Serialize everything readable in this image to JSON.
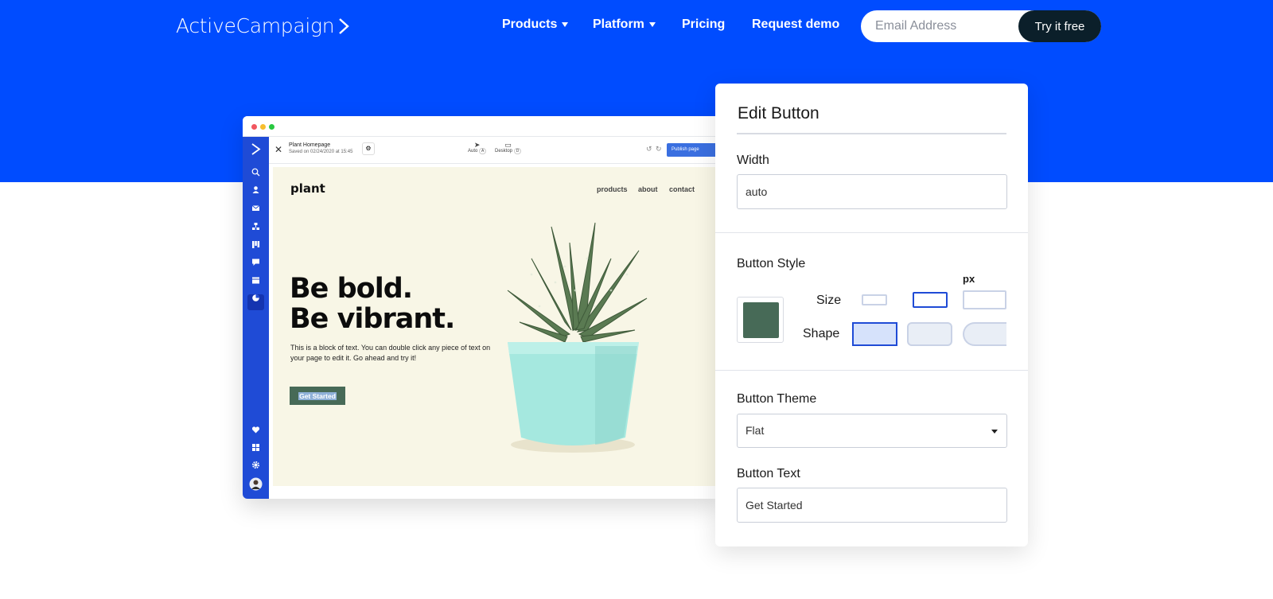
{
  "brand": {
    "name": "ActiveCampaign",
    "accent": "#004cff"
  },
  "nav": {
    "items": [
      {
        "label": "Products",
        "dropdown": true
      },
      {
        "label": "Platform",
        "dropdown": true
      },
      {
        "label": "Pricing",
        "dropdown": false
      },
      {
        "label": "Request demo",
        "dropdown": false
      }
    ],
    "email_placeholder": "Email Address",
    "cta_label": "Try it free"
  },
  "editor": {
    "page_name": "Plant Homepage",
    "saved_text": "Saved on 02/24/2020 at 15:45",
    "view_auto": "Auto",
    "view_auto_key": "A",
    "view_desktop": "Desktop",
    "view_desktop_key": "D",
    "publish_label": "Publish page",
    "sidebar_icons": [
      "search-icon",
      "contacts-icon",
      "email-icon",
      "automation-icon",
      "deals-icon",
      "conversations-icon",
      "pages-icon",
      "reports-icon",
      "heart-icon",
      "apps-icon",
      "settings-icon",
      "avatar"
    ]
  },
  "site": {
    "logo": "plant",
    "nav": [
      "products",
      "about",
      "contact"
    ],
    "headline_1": "Be bold.",
    "headline_2": "Be vibrant.",
    "paragraph": "This is a block of text. You can double click any piece of text on your page to edit it. Go ahead and try it!",
    "button_label": "Get Started",
    "button_color": "#476a57",
    "background": "#f8f6e6"
  },
  "panel": {
    "title": "Edit Button",
    "width_label": "Width",
    "width_value": "auto",
    "style_label": "Button Style",
    "unit": "px",
    "size_label": "Size",
    "shape_label": "Shape",
    "swatch_color": "#476a57",
    "theme_label": "Button Theme",
    "theme_value": "Flat",
    "text_label": "Button Text",
    "text_value": "Get Started"
  }
}
